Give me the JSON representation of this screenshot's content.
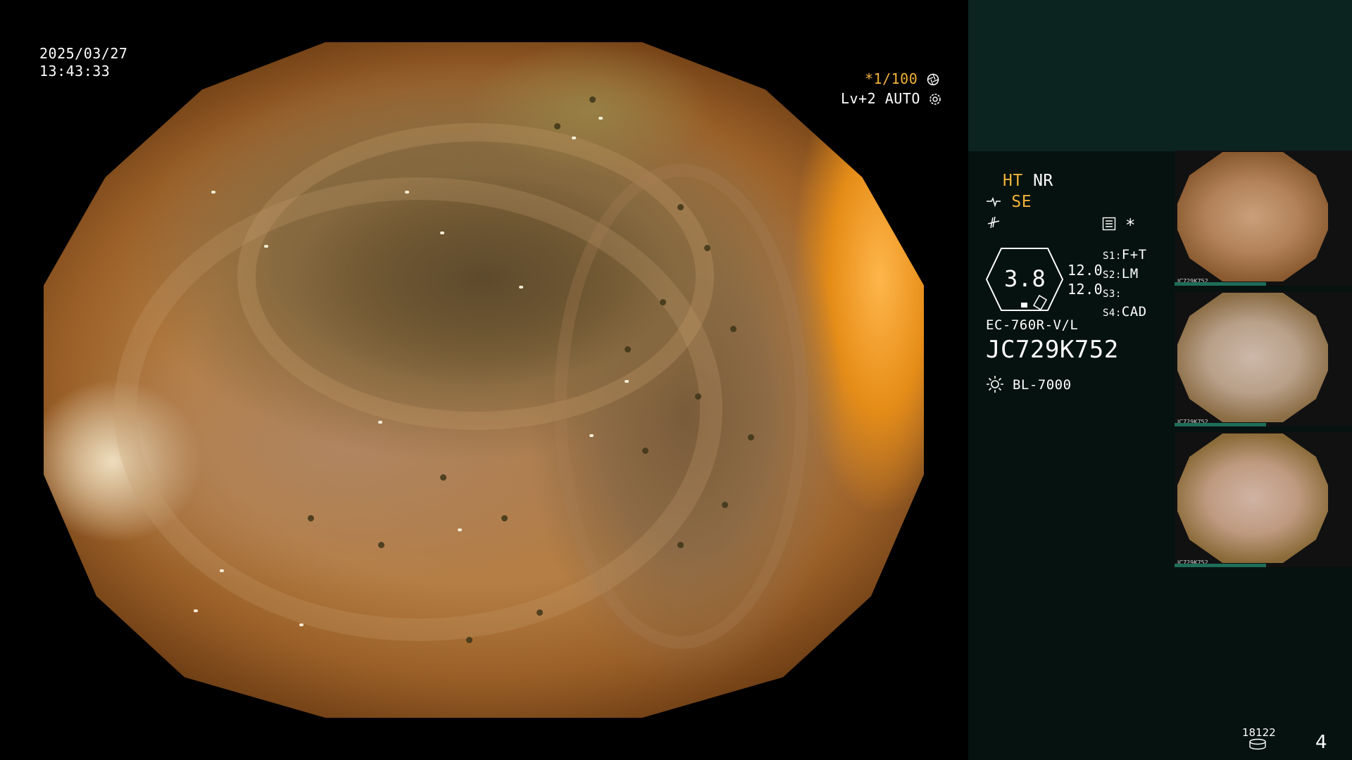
{
  "overlay": {
    "date": "2025/03/27",
    "time": "13:43:33",
    "shutter": "*1/100",
    "level": "Lv+2",
    "mode": "AUTO"
  },
  "panel": {
    "ht": "HT",
    "nr": "NR",
    "se": "SE",
    "star": "*",
    "zoom": "3.8",
    "values": [
      "12.0",
      "12.0"
    ],
    "switches": [
      {
        "key": "S1:",
        "value": "F+T"
      },
      {
        "key": "S2:",
        "value": "LM"
      },
      {
        "key": "S3:",
        "value": ""
      },
      {
        "key": "S4:",
        "value": "CAD"
      }
    ],
    "scope_model": "EC-760R-V/L",
    "serial": "JC729K752",
    "light_source": "BL-7000",
    "counter": "18122",
    "page": "4"
  },
  "thumbnails": [
    {
      "label": "JC729K752"
    },
    {
      "label": "JC729K752"
    },
    {
      "label": "JC729K752"
    }
  ],
  "colors": {
    "accent_yellow": "#f2b33a",
    "panel_bg": "#05120f",
    "panel_top_bg": "#0b2420",
    "thumb_bar": "#1d6d58"
  },
  "icons": [
    "aperture-icon",
    "gear-icon",
    "scope-icon",
    "freeze-icon",
    "menu-icon",
    "lamp-icon",
    "storage-icon"
  ]
}
